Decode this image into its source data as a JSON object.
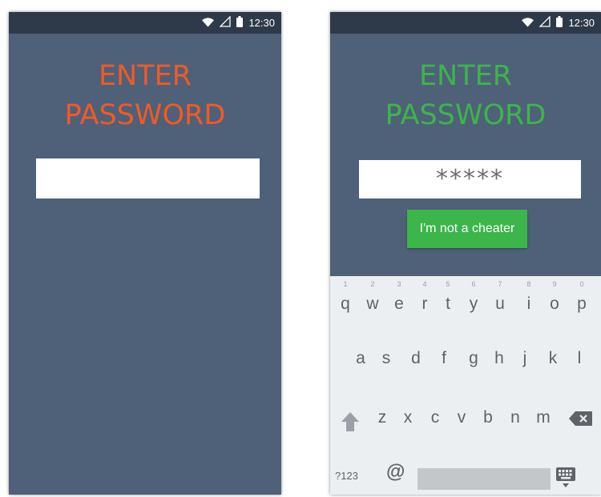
{
  "left_screen": {
    "status_bar": {
      "time": "12:30",
      "icons": [
        "wifi-icon",
        "signal-icon",
        "battery-icon"
      ]
    },
    "title_line1": "ENTER",
    "title_line2": "PASSWORD",
    "password_field": {
      "value": "",
      "placeholder": ""
    }
  },
  "right_screen": {
    "status_bar": {
      "time": "12:30",
      "icons": [
        "wifi-icon",
        "signal-icon",
        "battery-icon"
      ]
    },
    "title_line1": "ENTER",
    "title_line2": "PASSWORD",
    "password_field": {
      "value": "*****"
    },
    "button_label": "I'm not a cheater",
    "keyboard": {
      "row1_keys": [
        {
          "char": "q",
          "hint": "1"
        },
        {
          "char": "w",
          "hint": "2"
        },
        {
          "char": "e",
          "hint": "3"
        },
        {
          "char": "r",
          "hint": "4"
        },
        {
          "char": "t",
          "hint": "5"
        },
        {
          "char": "y",
          "hint": "6"
        },
        {
          "char": "u",
          "hint": "7"
        },
        {
          "char": "i",
          "hint": "8"
        },
        {
          "char": "o",
          "hint": "9"
        },
        {
          "char": "p",
          "hint": "0"
        }
      ],
      "row2_keys": [
        "a",
        "s",
        "d",
        "f",
        "g",
        "h",
        "j",
        "k",
        "l"
      ],
      "row3_keys": [
        "z",
        "x",
        "c",
        "v",
        "b",
        "n",
        "m"
      ],
      "symbols_label": "?123",
      "at_label": "@"
    }
  },
  "colors": {
    "screen_background": "#4f6079",
    "status_bar": "#2e3a4a",
    "title_left": "#f15a24",
    "title_right": "#3cb54a",
    "button": "#3cb54a",
    "keyboard_background": "#eceff1"
  }
}
